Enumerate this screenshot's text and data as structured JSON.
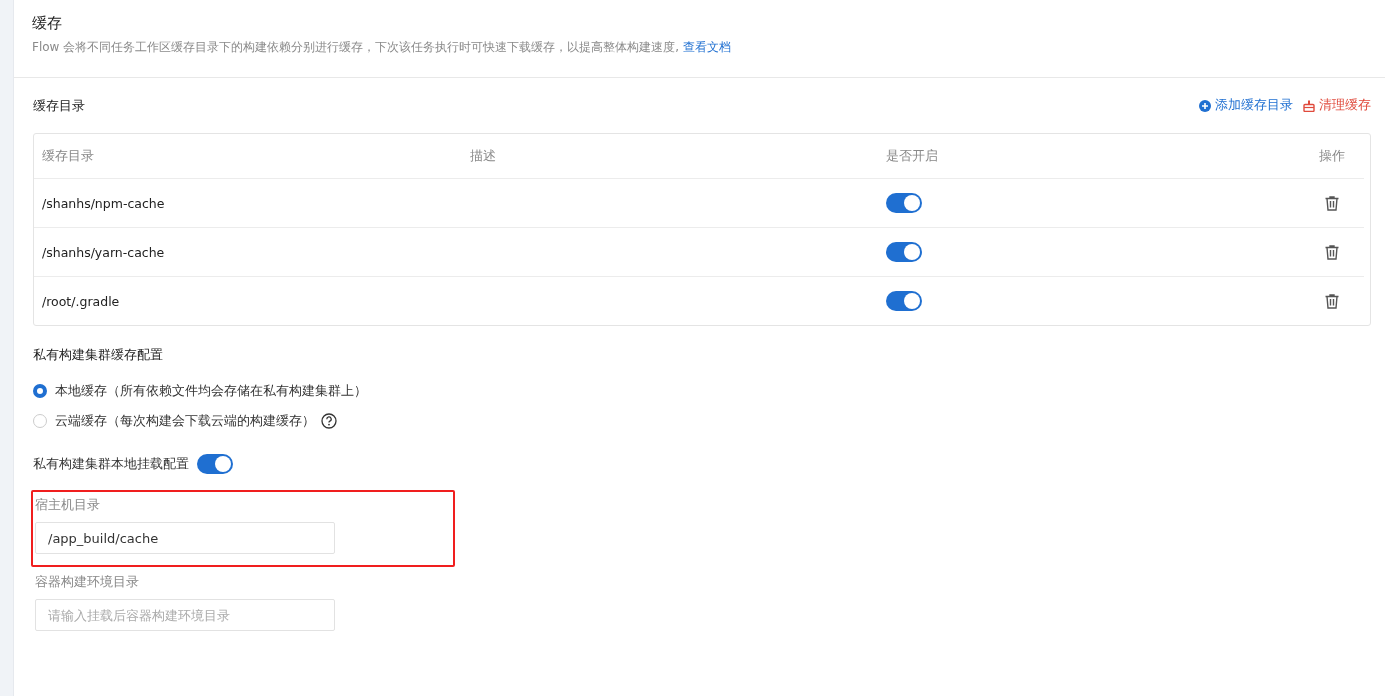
{
  "header": {
    "title": "缓存",
    "description": "Flow 会将不同任务工作区缓存目录下的构建依赖分别进行缓存，下次该任务执行时可快速下载缓存，以提高整体构建速度,",
    "doc_link": "查看文档"
  },
  "cache_dirs": {
    "title": "缓存目录",
    "add_action": "添加缓存目录",
    "clear_action": "清理缓存",
    "columns": [
      "缓存目录",
      "描述",
      "是否开启",
      "操作"
    ],
    "rows": [
      {
        "path": "/shanhs/npm-cache",
        "on": true
      },
      {
        "path": "/shanhs/yarn-cache",
        "on": true
      },
      {
        "path": "/root/.gradle",
        "on": true
      }
    ]
  },
  "cluster_cache": {
    "title": "私有构建集群缓存配置",
    "options": [
      {
        "label": "本地缓存（所有依赖文件均会存储在私有构建集群上）",
        "selected": true,
        "help": false
      },
      {
        "label": "云端缓存（每次构建会下载云端的构建缓存）",
        "selected": false,
        "help": true
      }
    ]
  },
  "mount": {
    "label": "私有构建集群本地挂载配置",
    "on": true,
    "fields": [
      {
        "label": "宿主机目录",
        "value": "/app_build/cache",
        "highlighted": true
      },
      {
        "label": "容器构建环境目录",
        "placeholder": "请输入挂载后容器构建环境目录",
        "highlighted": false
      }
    ]
  }
}
